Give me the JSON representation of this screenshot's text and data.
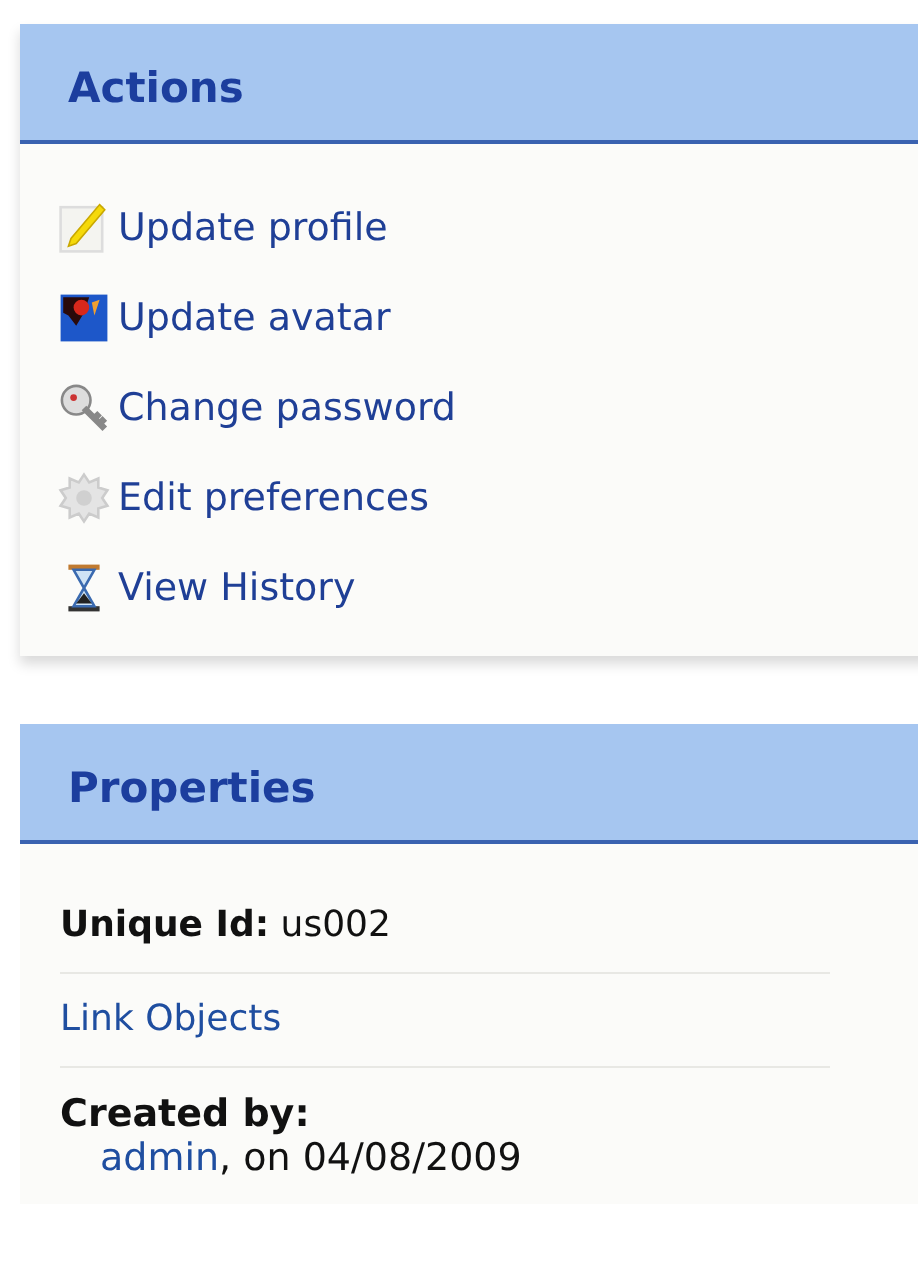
{
  "actions": {
    "title": "Actions",
    "items": [
      {
        "kind": "pencil",
        "label": "Update profile"
      },
      {
        "kind": "avatar",
        "label": "Update avatar"
      },
      {
        "kind": "key",
        "label": "Change password"
      },
      {
        "kind": "gear",
        "label": "Edit preferences"
      },
      {
        "kind": "hourglass",
        "label": "View History"
      }
    ]
  },
  "properties": {
    "title": "Properties",
    "unique_id": {
      "label": "Unique Id:",
      "value": "us002"
    },
    "link": "Link Objects",
    "created_by": {
      "label": "Created by:",
      "user": "admin",
      "rest": ", on 04/08/2009"
    }
  }
}
